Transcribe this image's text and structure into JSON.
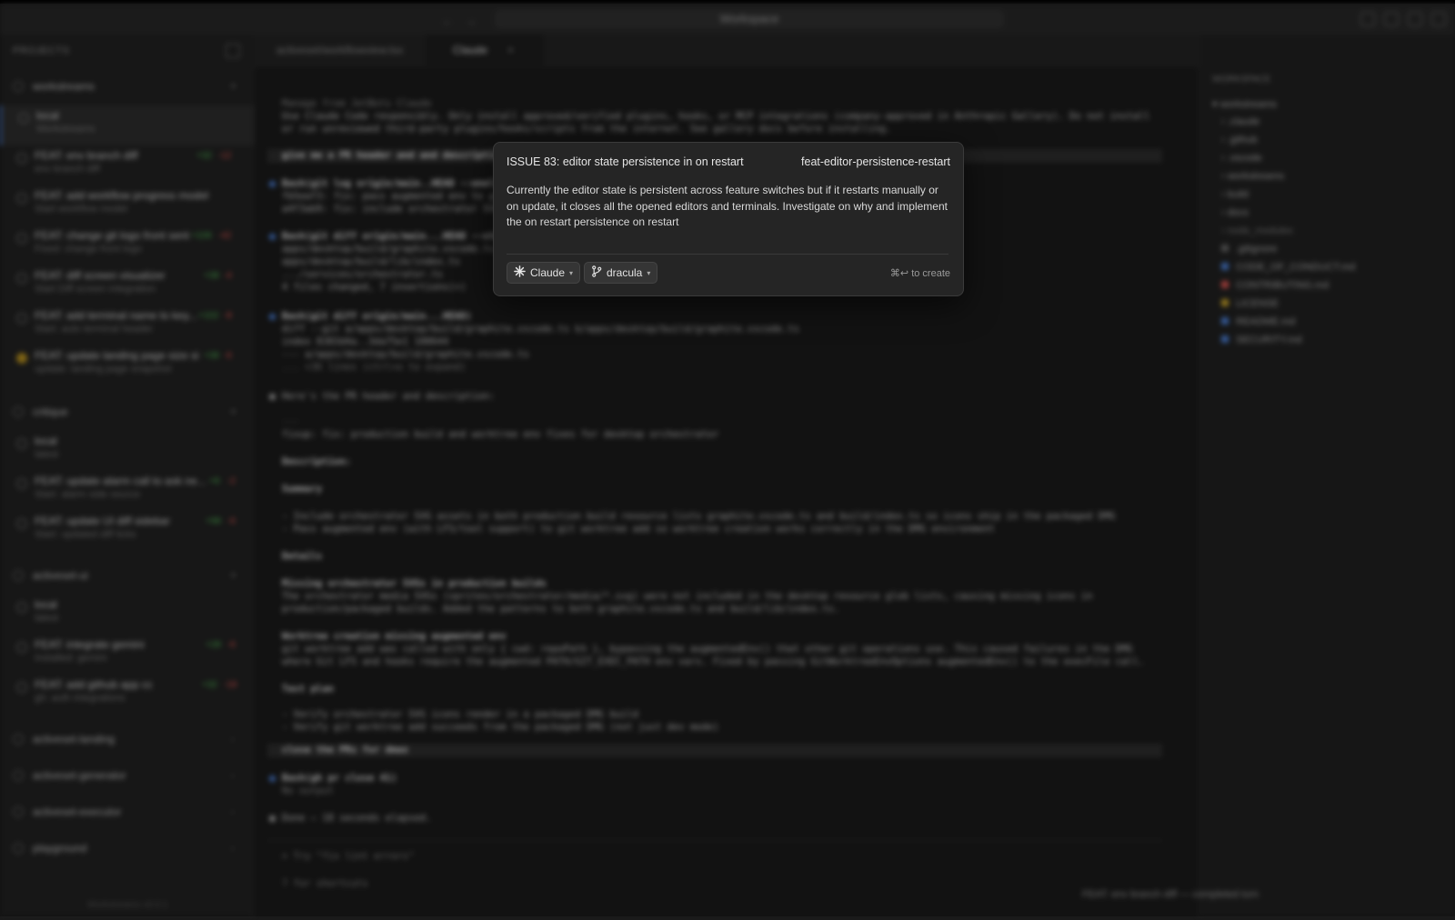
{
  "titlebar": {
    "search_label": "Workspace",
    "nav_back": "←",
    "nav_fwd": "→"
  },
  "sidebar": {
    "header": "PROJECTS",
    "projects": [
      {
        "name": "workstreams"
      },
      {
        "name": "critique"
      },
      {
        "name": "activeset-ui"
      },
      {
        "name": "activeset-landing"
      },
      {
        "name": "activeset-generator"
      },
      {
        "name": "activeset-executor"
      },
      {
        "name": "playground"
      }
    ],
    "workstreams": [
      {
        "title": "local",
        "sub": "Workstreams",
        "add": "",
        "del": ""
      },
      {
        "title": "FEAT: env branch diff",
        "sub": "env branch diff",
        "add": "+32",
        "del": "-12"
      },
      {
        "title": "FEAT: add workflow progress model",
        "sub": "Start workflow model",
        "add": "",
        "del": ""
      },
      {
        "title": "FEAT: change git logo front sent",
        "sub": "Fixed: change front logo",
        "add": "+108",
        "del": "-42"
      },
      {
        "title": "FEAT: diff screen visualizer",
        "sub": "Start Diff screen integration",
        "add": "+38",
        "del": "-4"
      },
      {
        "title": "FEAT: add terminal name to key...",
        "sub": "Start: auto terminal header",
        "add": "+102",
        "del": "-8"
      },
      {
        "title": "FEAT: update landing page size si",
        "sub": "update: landing page snapshot",
        "add": "+38",
        "del": "-6"
      }
    ],
    "critique": [
      {
        "title": "local",
        "sub": "latest",
        "add": "",
        "del": ""
      },
      {
        "title": "FEAT: update alarm call to ask ne...",
        "sub": "Start: alarm side source",
        "add": "+8",
        "del": "-2"
      },
      {
        "title": "FEAT: update UI diff sidebar",
        "sub": "Start: updated diff ticks",
        "add": "+98",
        "del": "-6"
      }
    ],
    "activeset": [
      {
        "title": "local",
        "sub": "latest",
        "add": "",
        "del": ""
      },
      {
        "title": "FEAT: integrate gemini",
        "sub": "Installed: gemini",
        "add": "+28",
        "del": "-6"
      },
      {
        "title": "FEAT: add github app cc",
        "sub": "gh: auth integrations",
        "add": "+32",
        "del": "-18"
      }
    ],
    "footer": "Workstreams v0.0.1"
  },
  "tabs": [
    {
      "label": "activeset/workflowview.tsx"
    },
    {
      "label": "Claude"
    }
  ],
  "main": {
    "lines": [
      "Manage from JetBots Claude",
      "Use Claude Code responsibly. Only install approved/verified plugins, hooks, or MCP integrations (company-approved in Anthropic Gallery). Do not install",
      "  or run unreviewed third-party plugins/hooks/scripts from the internet. See gallery docs before installing.",
      "give me a PR header and and description",
      "Bash(git log origin/main..HEAD --oneline)",
      "  fbSeaf3: fix: pass augmented env to git worktree add",
      "  a4f3ab9: fix: include orchestrator SVG assets in production build",
      "Bash(git diff origin/main...HEAD --stat)",
      "  apps/desktop/build/graphite.vscode.ts",
      "  apps/desktop/build/lib/index.ts",
      "  .../services/orchestrator.ts",
      "  4 files changed, 7 insertions(+)",
      "Bash(git diff origin/main...HEAD)",
      "  diff --git a/apps/desktop/build/graphite.vscode.ts b/apps/desktop/build/graphite.vscode.ts",
      "  index 8383d4a..3da75e1 100644",
      "  --- a/apps/desktop/build/graphite.vscode.ts",
      "  ... +36 lines (ctrl+o to expand)",
      "Here's the PR header and description:",
      "---",
      "fixup: fix: production build and worktree env fixes for desktop orchestrator",
      "Description:",
      "Summary",
      "- Include orchestrator SVG assets in both production build resource lists graphite.vscode.ts and build/index.ts so icons ship in the packaged DMG",
      "- Pass augmented env (with LFS/tool support) to git worktree add so worktree creation works correctly in the DMG environment",
      "Details",
      "Missing orchestrator SVGs in production builds",
      "The orchestrator media SVGs (sprites/orchestrator/media/*.svg) were not included in the desktop resource glob lists, causing missing icons in",
      "production/packaged builds. Added the patterns to both graphite.vscode.ts and build/lib/index.ts.",
      "Worktree creation missing augmented env",
      "git worktree add was called with only { cwd: repoPath }, bypassing the augmentedEnv() that other git operations use. This caused failures in the DMG",
      "where Git LFS and hooks require the augmented PATH/GIT_EXEC_PATH env vars. Fixed by passing GitWorktreeEnvOptions augmentedEnv() to the execFile call.",
      "Test plan",
      "- Verify orchestrator SVG icons render in a packaged DMG build",
      "- Verify git worktree add succeeds from the packaged DMG (not just dev mode)",
      "close the PRs for dmax",
      "Bash(gh pr close 41)",
      "  No output",
      "Done — 18 seconds elapsed.",
      "> Try \"fix lint errors\"",
      "? for shortcuts"
    ]
  },
  "rightpanel": {
    "header": "WORKSPACE",
    "root": "workstreams",
    "items": [
      ".claude",
      ".github",
      ".vscode",
      "workstreams",
      "build",
      "docs",
      "node_modules",
      ".gitignore",
      "CODE_OF_CONDUCT.md",
      "CONTRIBUTING.md",
      "LICENSE",
      "README.md",
      "SECURITY.md"
    ],
    "status": "FEAT: env branch diff — completed turn"
  },
  "dialog": {
    "title": "ISSUE 83: editor state persistence in on restart",
    "branch": "feat-editor-persistence-restart",
    "body": "Currently the editor state is persistent across feature switches but if it restarts manually or on update, it closes all the opened editors and terminals. Investigate on why and implement the on restart persistence on restart",
    "agent_label": "Claude",
    "theme_label": "dracula",
    "shortcut_hint": "⌘↩ to create"
  },
  "colors": {
    "accent": "#4a7fd6",
    "add": "#4caf50",
    "del": "#d9534f",
    "dialog_bg": "#252525"
  }
}
